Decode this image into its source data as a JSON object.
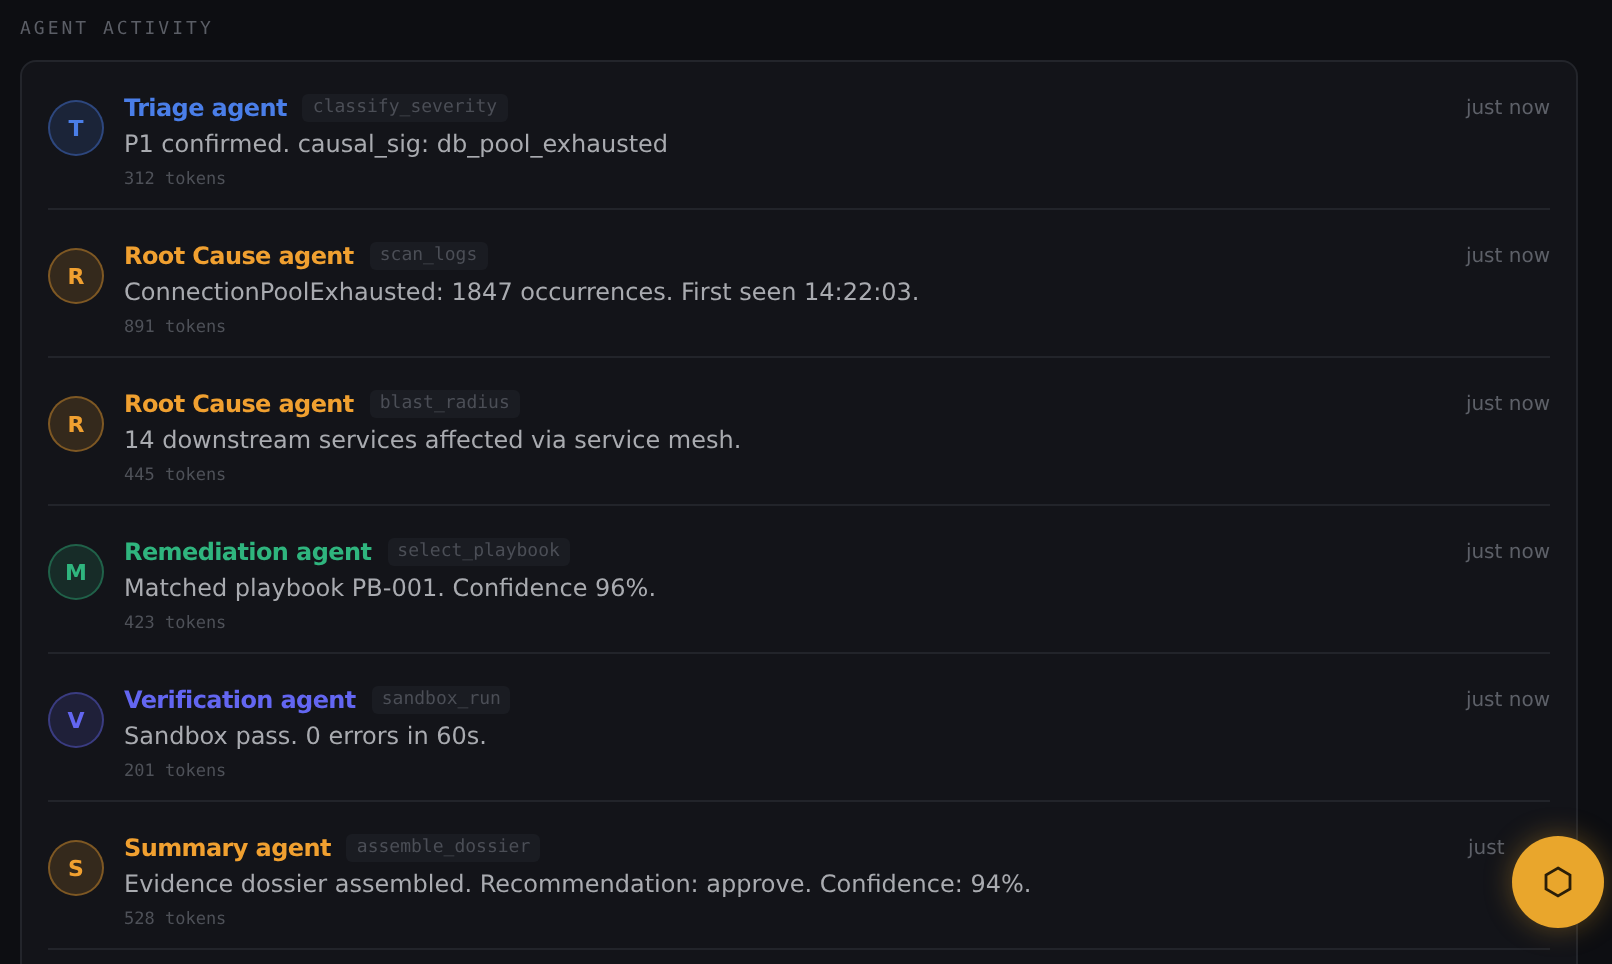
{
  "section_title": "AGENT ACTIVITY",
  "activity": [
    {
      "initial": "T",
      "agent": "Triage agent",
      "tool": "classify_severity",
      "message": "P1 confirmed. causal_sig: db_pool_exhausted",
      "tokens": "312 tokens",
      "time": "just now",
      "color": "#4a7ee8"
    },
    {
      "initial": "R",
      "agent": "Root Cause agent",
      "tool": "scan_logs",
      "message": "ConnectionPoolExhausted: 1847 occurrences. First seen 14:22:03.",
      "tokens": "891 tokens",
      "time": "just now",
      "color": "#f0a030"
    },
    {
      "initial": "R",
      "agent": "Root Cause agent",
      "tool": "blast_radius",
      "message": "14 downstream services affected via service mesh.",
      "tokens": "445 tokens",
      "time": "just now",
      "color": "#f0a030"
    },
    {
      "initial": "M",
      "agent": "Remediation agent",
      "tool": "select_playbook",
      "message": "Matched playbook PB-001. Confidence 96%.",
      "tokens": "423 tokens",
      "time": "just now",
      "color": "#2fb57e"
    },
    {
      "initial": "V",
      "agent": "Verification agent",
      "tool": "sandbox_run",
      "message": "Sandbox pass. 0 errors in 60s.",
      "tokens": "201 tokens",
      "time": "just now",
      "color": "#6366f1"
    },
    {
      "initial": "S",
      "agent": "Summary agent",
      "tool": "assemble_dossier",
      "message": "Evidence dossier assembled. Recommendation: approve. Confidence: 94%.",
      "tokens": "528 tokens",
      "time": "just",
      "color": "#f0a030"
    }
  ]
}
